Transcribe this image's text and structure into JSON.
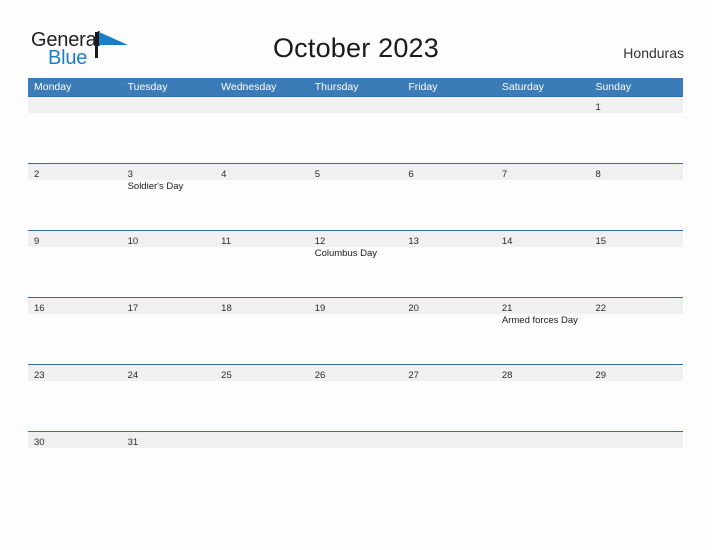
{
  "header": {
    "logo": {
      "text_primary": "General",
      "text_secondary": "Blue",
      "flag_icon": "blue-flag-triangle-icon",
      "primary_color": "#231f20",
      "secondary_color": "#1a7ec8"
    },
    "title": "October 2023",
    "country": "Honduras"
  },
  "colors": {
    "header_blue": "#3b7cb8",
    "row_divider_blue": "#2f6fae",
    "daynum_strip_gray": "#f0f0f0",
    "page_background": "#fdfdfd"
  },
  "calendar": {
    "day_headers": [
      "Monday",
      "Tuesday",
      "Wednesday",
      "Thursday",
      "Friday",
      "Saturday",
      "Sunday"
    ],
    "weeks": [
      [
        {
          "day": "",
          "event": ""
        },
        {
          "day": "",
          "event": ""
        },
        {
          "day": "",
          "event": ""
        },
        {
          "day": "",
          "event": ""
        },
        {
          "day": "",
          "event": ""
        },
        {
          "day": "",
          "event": ""
        },
        {
          "day": "1",
          "event": ""
        }
      ],
      [
        {
          "day": "2",
          "event": ""
        },
        {
          "day": "3",
          "event": "Soldier's Day"
        },
        {
          "day": "4",
          "event": ""
        },
        {
          "day": "5",
          "event": ""
        },
        {
          "day": "6",
          "event": ""
        },
        {
          "day": "7",
          "event": ""
        },
        {
          "day": "8",
          "event": ""
        }
      ],
      [
        {
          "day": "9",
          "event": ""
        },
        {
          "day": "10",
          "event": ""
        },
        {
          "day": "11",
          "event": ""
        },
        {
          "day": "12",
          "event": "Columbus Day"
        },
        {
          "day": "13",
          "event": ""
        },
        {
          "day": "14",
          "event": ""
        },
        {
          "day": "15",
          "event": ""
        }
      ],
      [
        {
          "day": "16",
          "event": ""
        },
        {
          "day": "17",
          "event": ""
        },
        {
          "day": "18",
          "event": ""
        },
        {
          "day": "19",
          "event": ""
        },
        {
          "day": "20",
          "event": ""
        },
        {
          "day": "21",
          "event": "Armed forces Day"
        },
        {
          "day": "22",
          "event": ""
        }
      ],
      [
        {
          "day": "23",
          "event": ""
        },
        {
          "day": "24",
          "event": ""
        },
        {
          "day": "25",
          "event": ""
        },
        {
          "day": "26",
          "event": ""
        },
        {
          "day": "27",
          "event": ""
        },
        {
          "day": "28",
          "event": ""
        },
        {
          "day": "29",
          "event": ""
        }
      ],
      [
        {
          "day": "30",
          "event": ""
        },
        {
          "day": "31",
          "event": ""
        },
        {
          "day": "",
          "event": ""
        },
        {
          "day": "",
          "event": ""
        },
        {
          "day": "",
          "event": ""
        },
        {
          "day": "",
          "event": ""
        },
        {
          "day": "",
          "event": ""
        }
      ]
    ]
  }
}
